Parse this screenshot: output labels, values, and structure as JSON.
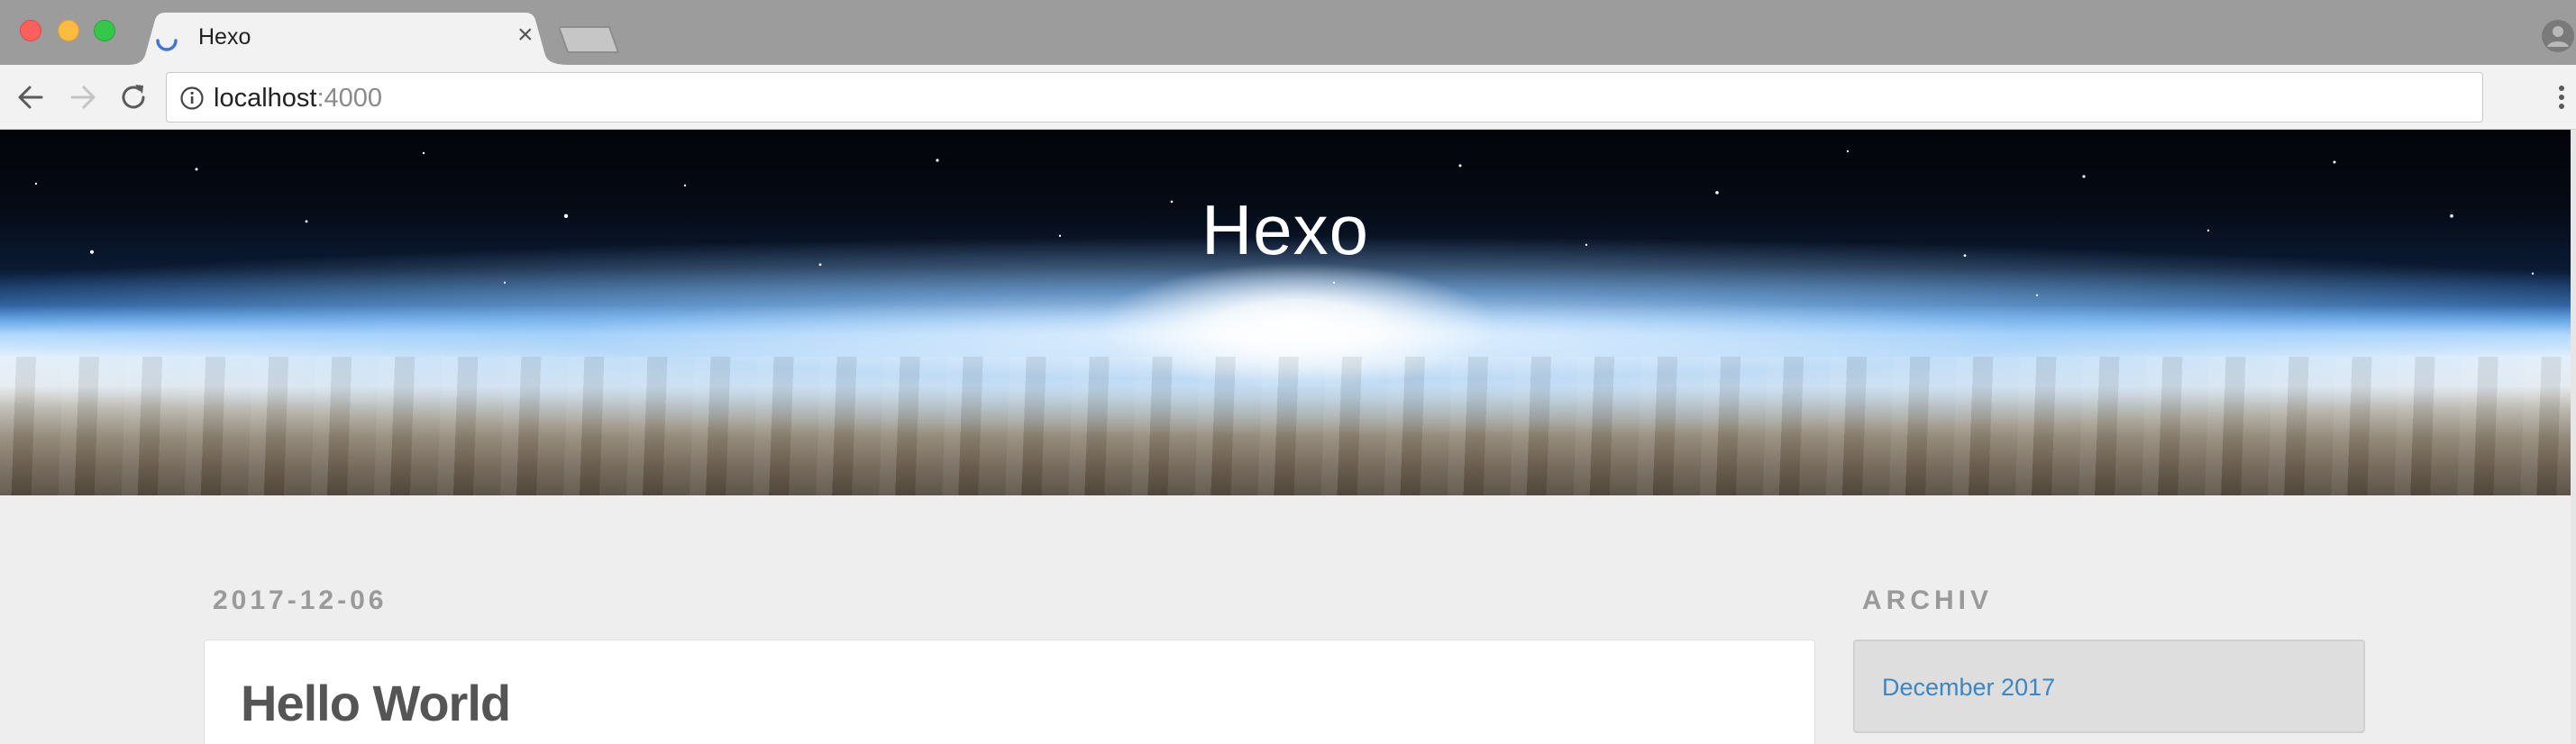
{
  "browser": {
    "tab_title": "Hexo",
    "tab_close": "×",
    "url_host": "localhost",
    "url_port": ":4000"
  },
  "page": {
    "site_title": "Hexo",
    "post_date": "2017-12-06",
    "post_title": "Hello World",
    "sidebar_heading": "ARCHIV",
    "archive_items": [
      "December 2017"
    ]
  },
  "colors": {
    "link": "#3a87c4",
    "heading_muted": "#9a9a9a",
    "title_text": "#555555"
  }
}
